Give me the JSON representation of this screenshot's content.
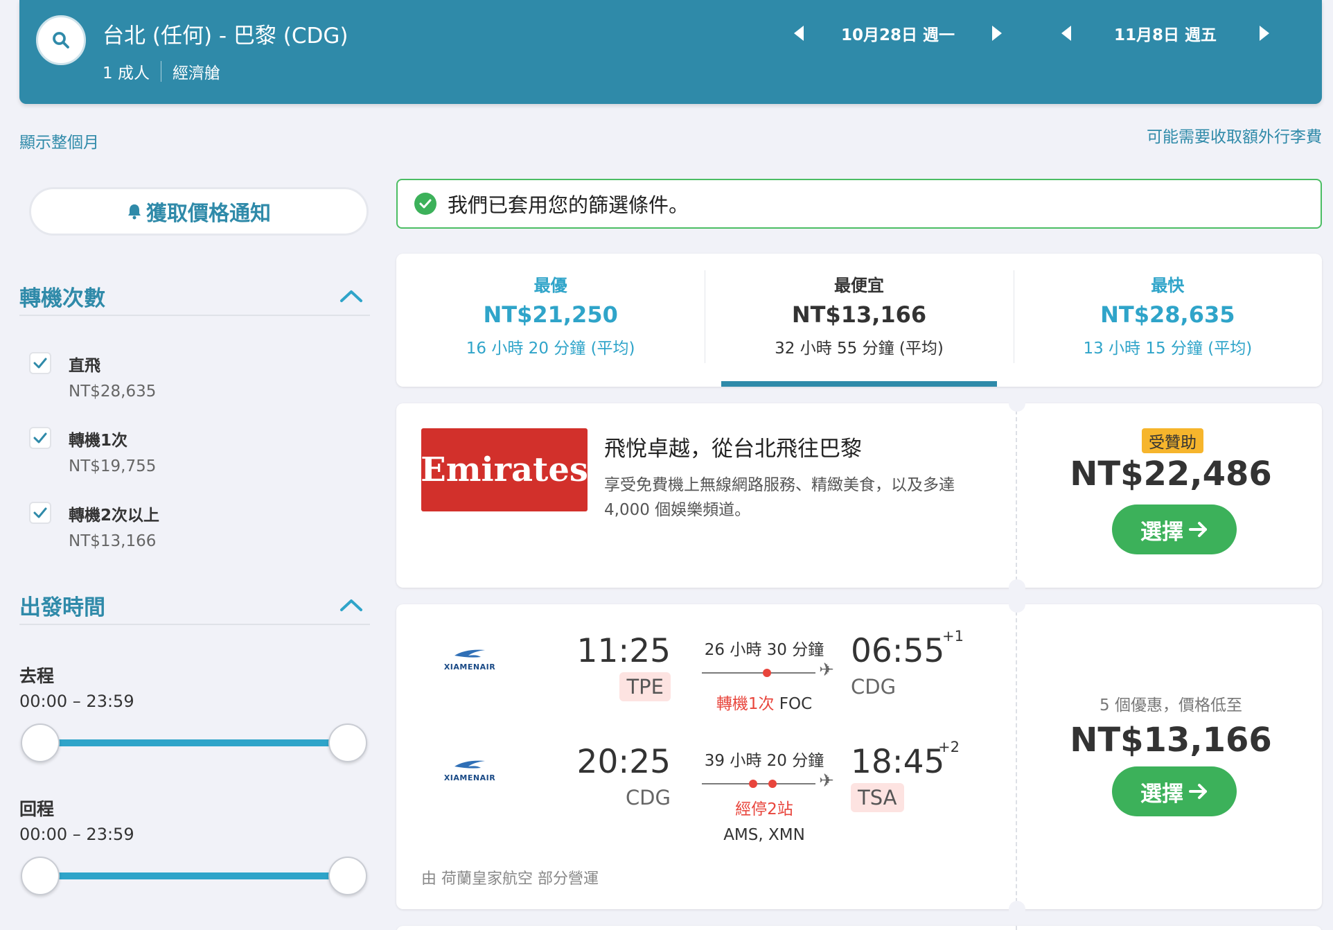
{
  "header": {
    "route": "台北 (任何) - 巴黎 (CDG)",
    "passengers": "1 成人",
    "cabin": "經濟艙",
    "depart_date": "10月28日 週一",
    "return_date": "11月8日 週五"
  },
  "links": {
    "show_month": "顯示整個月",
    "baggage_fee": "可能需要收取額外行李費"
  },
  "sidebar": {
    "price_alert": "獲取價格通知",
    "stops": {
      "title": "轉機次數",
      "options": [
        {
          "label": "直飛",
          "price": "NT$28,635",
          "checked": true
        },
        {
          "label": "轉機1次",
          "price": "NT$19,755",
          "checked": true
        },
        {
          "label": "轉機2次以上",
          "price": "NT$13,166",
          "checked": true
        }
      ]
    },
    "departure_time": {
      "title": "出發時間",
      "outbound_label": "去程",
      "outbound_range": "00:00 – 23:59",
      "return_label": "回程",
      "return_range": "00:00 – 23:59"
    }
  },
  "filter_notice": "我們已套用您的篩選條件。",
  "sort_tabs": [
    {
      "name": "最優",
      "price": "NT$21,250",
      "duration": "16 小時 20 分鐘 (平均)"
    },
    {
      "name": "最便宜",
      "price": "NT$13,166",
      "duration": "32 小時 55 分鐘 (平均)"
    },
    {
      "name": "最快",
      "price": "NT$28,635",
      "duration": "13 小時 15 分鐘 (平均)"
    }
  ],
  "ad": {
    "logo_text": "Emirates",
    "title": "飛悅卓越，從台北飛往巴黎",
    "description": "享受免費機上無線網路服務、精緻美食，以及多達 4,000 個娛樂頻道。",
    "badge": "受贊助",
    "price": "NT$22,486",
    "select": "選擇"
  },
  "result": {
    "outbound": {
      "airline_logo": "XIAMENAIR",
      "depart_time": "11:25",
      "depart_airport": "TPE",
      "duration": "26 小時 30 分鐘",
      "stops": "轉機1次",
      "via": "FOC",
      "arrive_time": "06:55",
      "day_offset": "+1",
      "arrive_airport": "CDG"
    },
    "return": {
      "airline_logo": "XIAMENAIR",
      "depart_time": "20:25",
      "depart_airport": "CDG",
      "duration": "39 小時 20 分鐘",
      "stops": "經停2站",
      "via": "AMS, XMN",
      "arrive_time": "18:45",
      "day_offset": "+2",
      "arrive_airport": "TSA"
    },
    "operated_by": "由 荷蘭皇家航空 部分營運",
    "deals": "5 個優惠，價格低至",
    "price": "NT$13,166",
    "select": "選擇"
  },
  "colors": {
    "header_bg": "#2f8aa9",
    "accent": "#2fa4c9",
    "green": "#3cb15a",
    "red": "#e8453c",
    "sponsor": "#f6b52c",
    "emirates": "#d2302b"
  }
}
